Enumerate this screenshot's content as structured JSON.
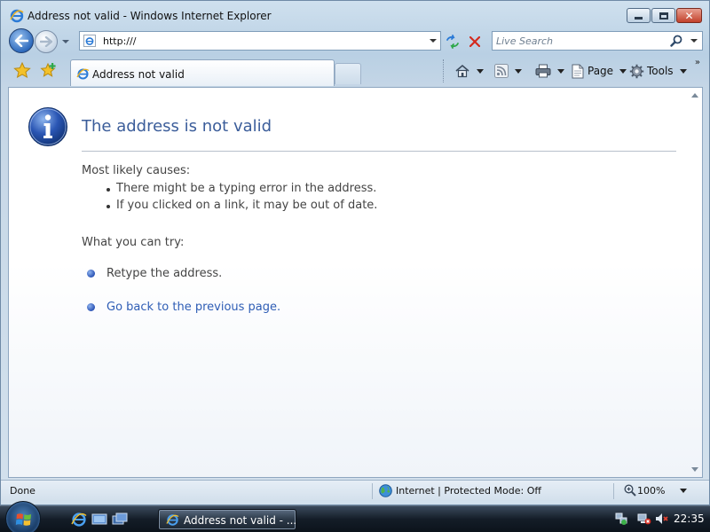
{
  "window": {
    "title": "Address not valid - Windows Internet Explorer"
  },
  "nav": {
    "address": "http:///",
    "search_placeholder": "Live Search"
  },
  "tabs": [
    {
      "label": "Address not valid"
    }
  ],
  "commands": {
    "page_label": "Page",
    "tools_label": "Tools"
  },
  "content": {
    "heading": "The address is not valid",
    "causes_title": "Most likely causes:",
    "causes": [
      "There might be a typing error in the address.",
      "If you clicked on a link, it may be out of date."
    ],
    "try_title": "What you can try:",
    "try_items": [
      {
        "text": "Retype the address."
      },
      {
        "text": "Go back to the previous page."
      }
    ]
  },
  "status": {
    "left_text": "Done",
    "zone_text": "Internet | Protected Mode: Off",
    "zoom": "100%"
  },
  "taskbar": {
    "task_label": "Address not valid - ...",
    "clock": "22:35"
  },
  "colors": {
    "heading": "#3b5d9a",
    "link": "#2e5db5"
  },
  "icons": {
    "ie": "ie-logo-icon",
    "info": "info-icon",
    "favorites": "star-icon",
    "add_favorite": "add-favorite-icon",
    "home": "home-icon",
    "feeds": "feeds-icon",
    "print": "print-icon",
    "page": "page-icon",
    "tools": "gear-icon",
    "search": "magnifier-icon",
    "refresh": "refresh-icon",
    "stop": "stop-icon",
    "zone": "globe-icon",
    "zoom": "zoom-icon"
  }
}
